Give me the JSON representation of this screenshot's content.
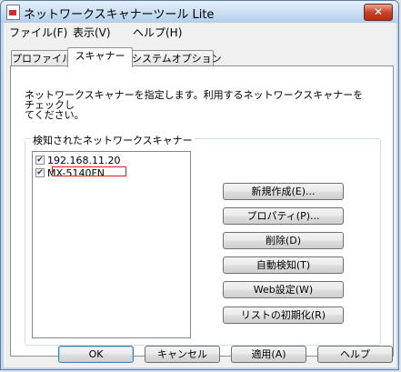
{
  "window": {
    "title": "ネットワークスキャナーツール Lite",
    "close_label": "✕"
  },
  "menubar": {
    "items": [
      "ファイル(F)",
      "表示(V)",
      "ヘルプ(H)"
    ]
  },
  "tabs": [
    {
      "label": "プロファイル",
      "active": false
    },
    {
      "label": "スキャナー",
      "active": true
    },
    {
      "label": "システムオプション",
      "active": false
    }
  ],
  "scanner_tab": {
    "description_line1": "ネットワークスキャナーを指定します。利用するネットワークスキャナーをチェックし",
    "description_line2": "てください。",
    "group_label": "検知されたネットワークスキャナー",
    "scanners": [
      {
        "label": "192.168.11.20",
        "checked": true,
        "highlighted": true
      },
      {
        "label": "MX-5140FN",
        "checked": true,
        "highlighted": false
      }
    ],
    "buttons": {
      "new": "新規作成(E)...",
      "properties": "プロパティ(P)...",
      "delete": "削除(D)",
      "auto_detect": "自動検知(T)",
      "web_settings": "Web設定(W)",
      "reset_list": "リストの初期化(R)"
    }
  },
  "footer": {
    "ok": "OK",
    "cancel": "キャンセル",
    "apply": "適用(A)",
    "help": "ヘルプ"
  },
  "colors": {
    "highlight_border": "#e02020",
    "check_mark": "#1a3a78"
  }
}
